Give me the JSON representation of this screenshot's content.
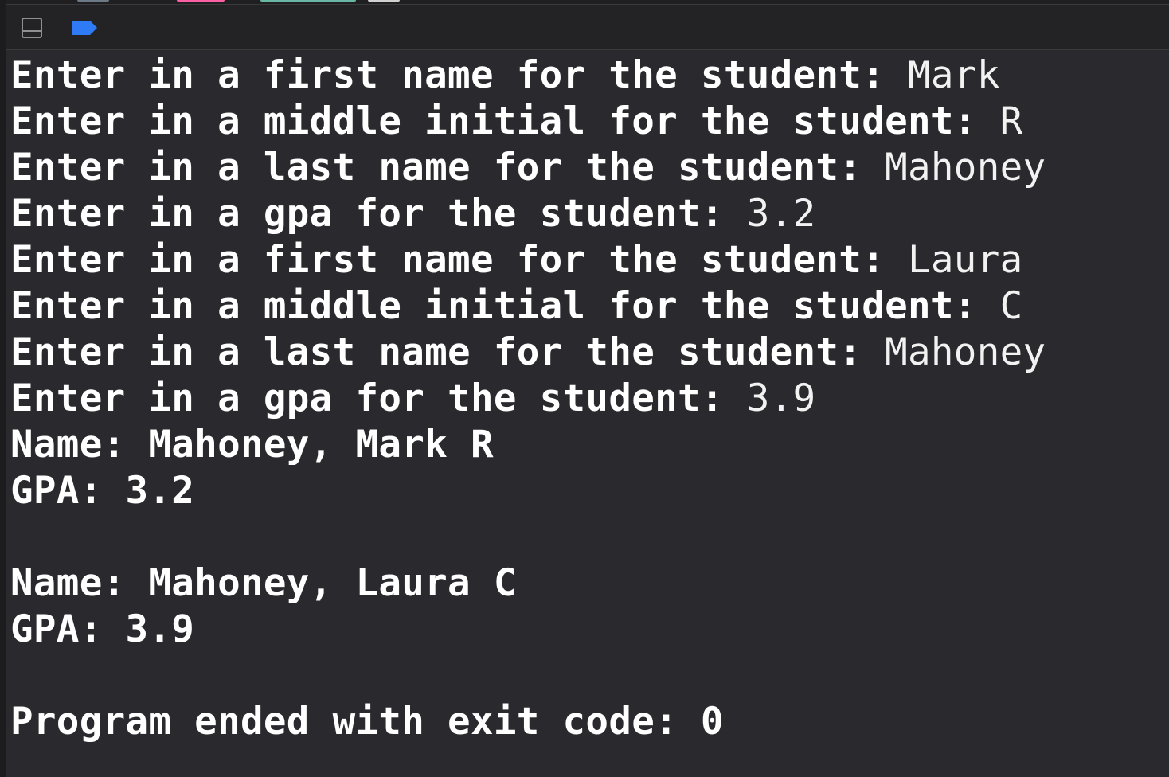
{
  "toolbar": {
    "toggle_icon": "panel-toggle-icon",
    "breakpoint_icon": "breakpoint-icon",
    "accent_color": "#2f7bf6"
  },
  "console": {
    "lines": [
      {
        "prompt": "Enter in a first name for the student: ",
        "input": "Mark"
      },
      {
        "prompt": "Enter in a middle initial for the student: ",
        "input": "R"
      },
      {
        "prompt": "Enter in a last name for the student: ",
        "input": "Mahoney"
      },
      {
        "prompt": "Enter in a gpa for the student: ",
        "input": "3.2"
      },
      {
        "prompt": "Enter in a first name for the student: ",
        "input": "Laura"
      },
      {
        "prompt": "Enter in a middle initial for the student: ",
        "input": "C"
      },
      {
        "prompt": "Enter in a last name for the student: ",
        "input": "Mahoney"
      },
      {
        "prompt": "Enter in a gpa for the student: ",
        "input": "3.9"
      }
    ],
    "output": [
      "Name: Mahoney, Mark R",
      "GPA: 3.2",
      "",
      "Name: Mahoney, Laura C",
      "GPA: 3.9",
      "",
      "Program ended with exit code: 0"
    ]
  }
}
